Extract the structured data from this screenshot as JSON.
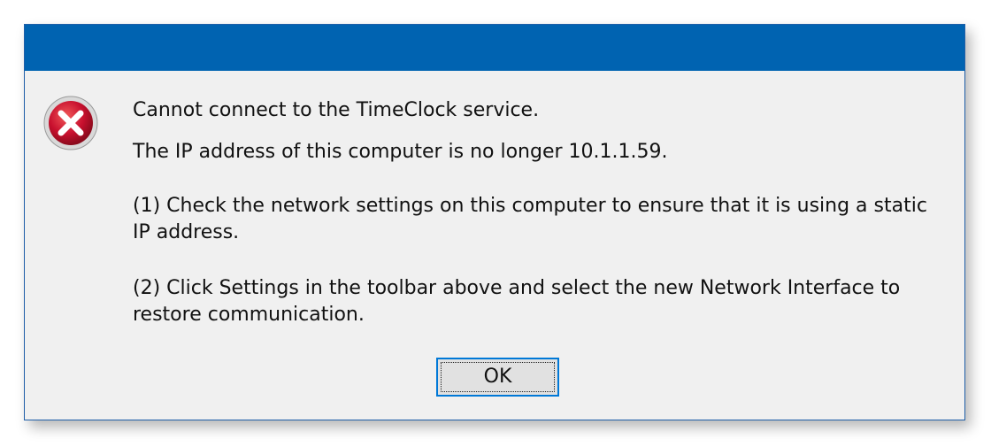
{
  "dialog": {
    "icon": "error-icon",
    "line1": "Cannot connect to the TimeClock service.",
    "line2": "The IP address of this computer is no longer 10.1.1.59.",
    "paragraph1": "(1) Check the network settings on this computer to ensure that it is using a static IP address.",
    "paragraph2": "(2) Click Settings in the toolbar above and select the new Network Interface to restore communication.",
    "ok_label": "OK"
  },
  "colors": {
    "titlebar": "#0063b1",
    "background": "#f0f0f0",
    "error_red": "#c8102e",
    "button_focus": "#0078d7"
  }
}
